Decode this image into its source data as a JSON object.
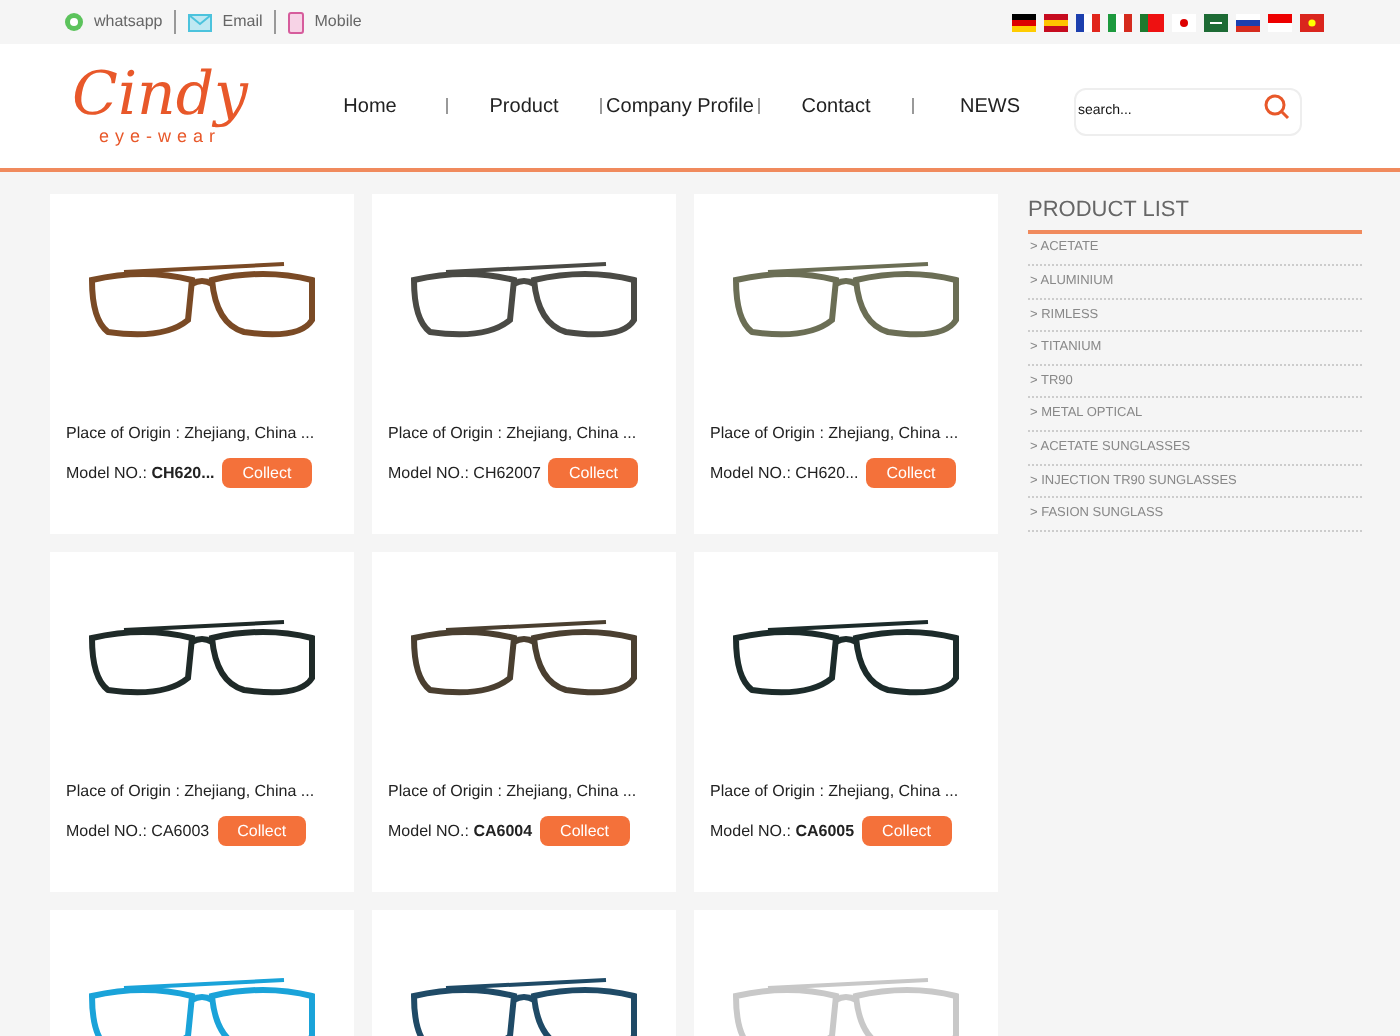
{
  "topbar": {
    "contacts": [
      {
        "kind": "whatsapp",
        "label": "whatsapp"
      },
      {
        "kind": "email",
        "label": "Email"
      },
      {
        "kind": "mobile",
        "label": "Mobile"
      }
    ],
    "flags": [
      {
        "kind": "de"
      },
      {
        "kind": "es"
      },
      {
        "kind": "fr"
      },
      {
        "kind": "it"
      },
      {
        "kind": "pt"
      },
      {
        "kind": "jp"
      },
      {
        "kind": "sa"
      },
      {
        "kind": "ru"
      },
      {
        "kind": "id"
      },
      {
        "kind": "vn"
      }
    ]
  },
  "logo": {
    "name": "Cindy",
    "tagline": "eye-wear"
  },
  "nav": [
    "Home",
    "Product",
    "Company Profile",
    "Contact",
    "NEWS"
  ],
  "search": {
    "placeholder": "search..."
  },
  "products": [
    {
      "origin": "Place of Origin : Zhejiang, China ...",
      "model": "Model NO.: **CH620...**",
      "button": "Collect",
      "color": "#7a4a25"
    },
    {
      "origin": "Place of Origin : Zhejiang, China ...",
      "model": "Model NO.: CH62007",
      "button": "Collect",
      "color": "#4a4a45"
    },
    {
      "origin": "Place of Origin : Zhejiang, China ...",
      "model": "Model NO.: CH620...",
      "button": "Collect",
      "color": "#6b6e55"
    },
    {
      "origin": "Place of Origin : Zhejiang, China ...",
      "model": "Model NO.: CA6003",
      "button": "Collect",
      "color": "#1f2a28"
    },
    {
      "origin": "Place of Origin : Zhejiang, China ...",
      "model": "Model NO.: **CA6004**",
      "button": "Collect",
      "color": "#4a3f30"
    },
    {
      "origin": "Place of Origin : Zhejiang, China ...",
      "model": "Model NO.: **CA6005**",
      "button": "Collect",
      "color": "#1c2b2a"
    },
    {
      "color": "#1aa3d9"
    },
    {
      "color": "#1f4a66"
    },
    {
      "color": "#c8c8c8"
    }
  ],
  "sidebar": {
    "title": "PRODUCT LIST",
    "items": [
      "> ACETATE",
      "> ALUMINIUM",
      "> RIMLESS",
      "> TITANIUM",
      "> TR90",
      "> METAL OPTICAL",
      "> ACETATE SUNGLASSES",
      "> INJECTION TR90 SUNGLASSES",
      "> FASION SUNGLASS"
    ]
  }
}
